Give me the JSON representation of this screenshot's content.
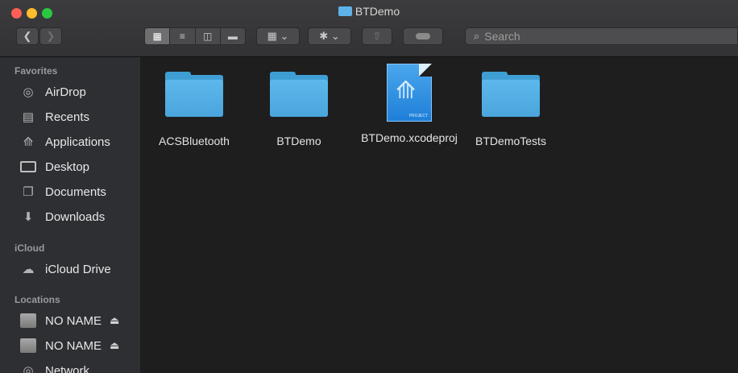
{
  "window": {
    "title": "BTDemo"
  },
  "toolbar": {
    "back_icon": "chevron-left-icon",
    "forward_icon": "chevron-right-icon",
    "view_modes": [
      "icon-view",
      "list-view",
      "column-view",
      "gallery-view"
    ],
    "search_placeholder": "Search"
  },
  "sidebar": {
    "favorites_heading": "Favorites",
    "favorites": [
      {
        "label": "AirDrop",
        "icon": "airdrop-icon"
      },
      {
        "label": "Recents",
        "icon": "recents-icon"
      },
      {
        "label": "Applications",
        "icon": "applications-icon"
      },
      {
        "label": "Desktop",
        "icon": "desktop-icon"
      },
      {
        "label": "Documents",
        "icon": "documents-icon"
      },
      {
        "label": "Downloads",
        "icon": "downloads-icon"
      }
    ],
    "icloud_heading": "iCloud",
    "icloud": [
      {
        "label": "iCloud Drive",
        "icon": "cloud-icon"
      }
    ],
    "locations_heading": "Locations",
    "locations": [
      {
        "label": "NO NAME",
        "icon": "drive-icon"
      },
      {
        "label": "NO NAME",
        "icon": "drive-icon"
      },
      {
        "label": "Network",
        "icon": "network-icon"
      }
    ]
  },
  "files": [
    {
      "name": "ACSBluetooth",
      "kind": "folder"
    },
    {
      "name": "BTDemo",
      "kind": "folder"
    },
    {
      "name": "BTDemo.xcodeproj",
      "kind": "xcode-project"
    },
    {
      "name": "BTDemoTests",
      "kind": "folder"
    }
  ],
  "colors": {
    "folder": "#4aa5dc",
    "sidebar": "#2e2f33",
    "content": "#1e1e1f"
  }
}
